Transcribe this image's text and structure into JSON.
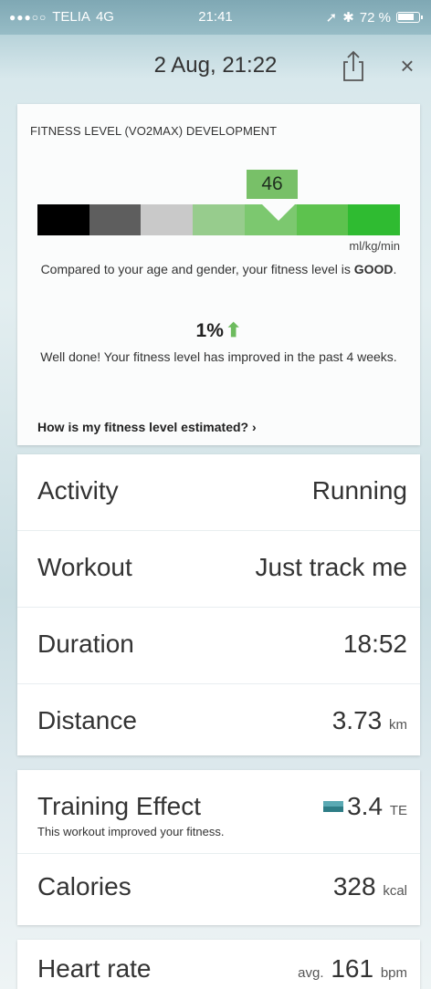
{
  "status": {
    "carrier": "TELIA",
    "network": "4G",
    "time": "21:41",
    "battery": "72 %",
    "signal_dots": "●●●○○",
    "location_icon": "➚",
    "bluetooth_icon": "✱"
  },
  "nav": {
    "title": "2 Aug, 21:22",
    "close_label": "×",
    "share_icon": "share-icon"
  },
  "fitness": {
    "title": "FITNESS LEVEL (VO2MAX) DEVELOPMENT",
    "value": "46",
    "unit": "ml/kg/min",
    "compare_text": "Compared to your age and gender, your fitness level is",
    "level": "GOOD",
    "change": "1%",
    "change_arrow": "🠅",
    "welldone": "Well done! Your fitness level has improved in the past 4 weeks.",
    "link": "How is my fitness level estimated? ›",
    "scale_colors": [
      "#000000",
      "#5e5e5e",
      "#c9c9c9",
      "#97cc8d",
      "#7cc86f",
      "#5dc24e",
      "#2fbb31"
    ]
  },
  "summary": [
    {
      "label": "Activity",
      "value": "Running",
      "unit": ""
    },
    {
      "label": "Workout",
      "value": "Just track me",
      "unit": ""
    },
    {
      "label": "Duration",
      "value": "18:52",
      "unit": ""
    },
    {
      "label": "Distance",
      "value": "3.73",
      "unit": "km"
    }
  ],
  "training": {
    "label": "Training Effect",
    "subtitle": "This workout improved your fitness.",
    "value": "3.4",
    "unit": "TE"
  },
  "calories": {
    "label": "Calories",
    "value": "328",
    "unit": "kcal"
  },
  "heart": {
    "label": "Heart rate",
    "prefix": "avg.",
    "value": "161",
    "unit": "bpm"
  }
}
